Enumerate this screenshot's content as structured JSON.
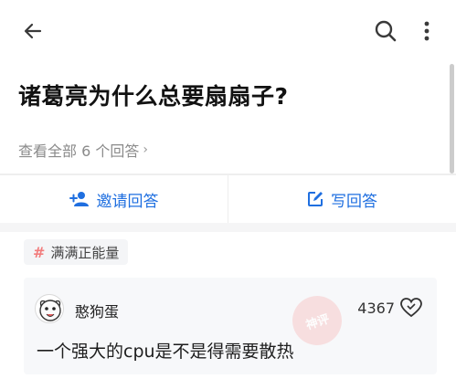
{
  "header": {
    "back_icon": "arrow-left-icon",
    "search_icon": "search-icon",
    "more_icon": "more-vertical-icon"
  },
  "question": {
    "title": "诸葛亮为什么总要扇扇子?",
    "view_all": "查看全部 6 个回答",
    "view_all_chevron": "›"
  },
  "actions": {
    "invite": {
      "label": "邀请回答",
      "icon": "invite-person-icon"
    },
    "write": {
      "label": "写回答",
      "icon": "edit-square-icon"
    }
  },
  "topic": {
    "hash": "#",
    "label": "满满正能量"
  },
  "answer": {
    "author": "憨狗蛋",
    "likes": "4367",
    "like_icon": "heart-like-icon",
    "text": "一个强大的cpu是不是得需要散热"
  },
  "watermark": {
    "text": "神评"
  },
  "colors": {
    "accent": "#1f6fe0",
    "tag_hash": "#f27d7d",
    "muted_text": "#8a8a8a"
  }
}
